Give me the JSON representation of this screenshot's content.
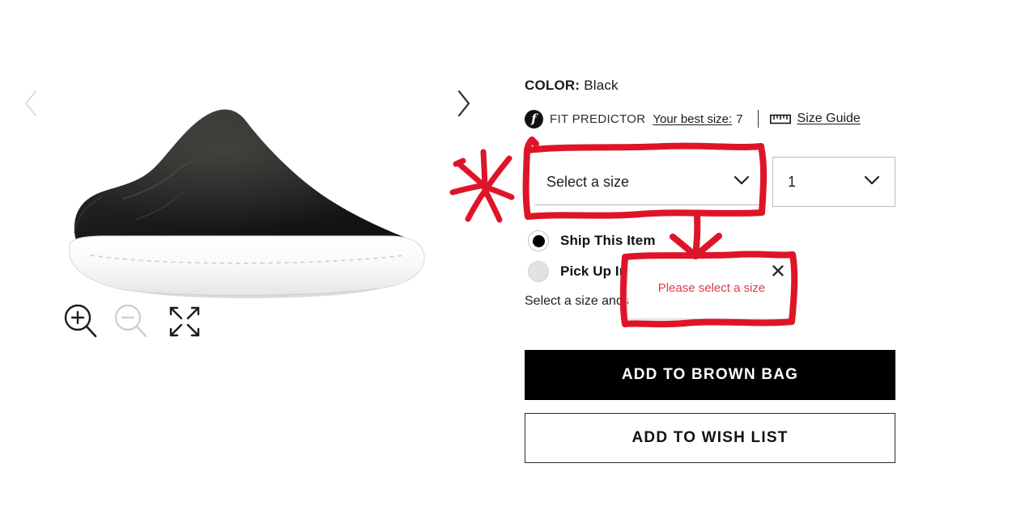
{
  "gallery": {
    "prev_arrow_icon": "chevron-left-icon",
    "next_arrow_icon": "chevron-right-icon",
    "product_image_alt": "Black suede slip-on mule sneaker with white platform sole",
    "controls": [
      {
        "name": "zoom-in-icon",
        "state": "enabled"
      },
      {
        "name": "zoom-out-icon",
        "state": "disabled"
      },
      {
        "name": "fullscreen-icon",
        "state": "enabled"
      }
    ]
  },
  "details": {
    "color_label": "COLOR:",
    "color_value": "Black",
    "fit_predictor": {
      "badge_glyph": "f",
      "label": "FIT PREDICTOR",
      "best_size_label": "Your best size:",
      "best_size_value": "7",
      "ruler_icon": "ruler-icon",
      "size_guide_label": "Size Guide"
    },
    "size_select": {
      "value": "Select a size",
      "chevron_icon": "chevron-down-icon"
    },
    "qty_select": {
      "value": "1",
      "chevron_icon": "chevron-down-icon"
    },
    "fulfillment": [
      {
        "label": "Ship This Item",
        "selected": true
      },
      {
        "label": "Pick Up In",
        "selected": false
      }
    ],
    "ship_note": "Select a size and                                and in-store availability.",
    "add_to_bag_label": "ADD TO BROWN BAG",
    "add_to_wish_label": "ADD TO WISH LIST"
  },
  "error_tooltip": {
    "message": "Please select a size",
    "close_icon": "close-icon"
  },
  "annotations": {
    "color": "#DE1528",
    "marks": [
      {
        "name": "asterisk-mark",
        "kind": "starburst"
      },
      {
        "name": "size-highlight-box",
        "kind": "rectangle"
      },
      {
        "name": "pointer-arrow",
        "kind": "arrow"
      },
      {
        "name": "error-highlight-box",
        "kind": "rectangle"
      }
    ]
  }
}
